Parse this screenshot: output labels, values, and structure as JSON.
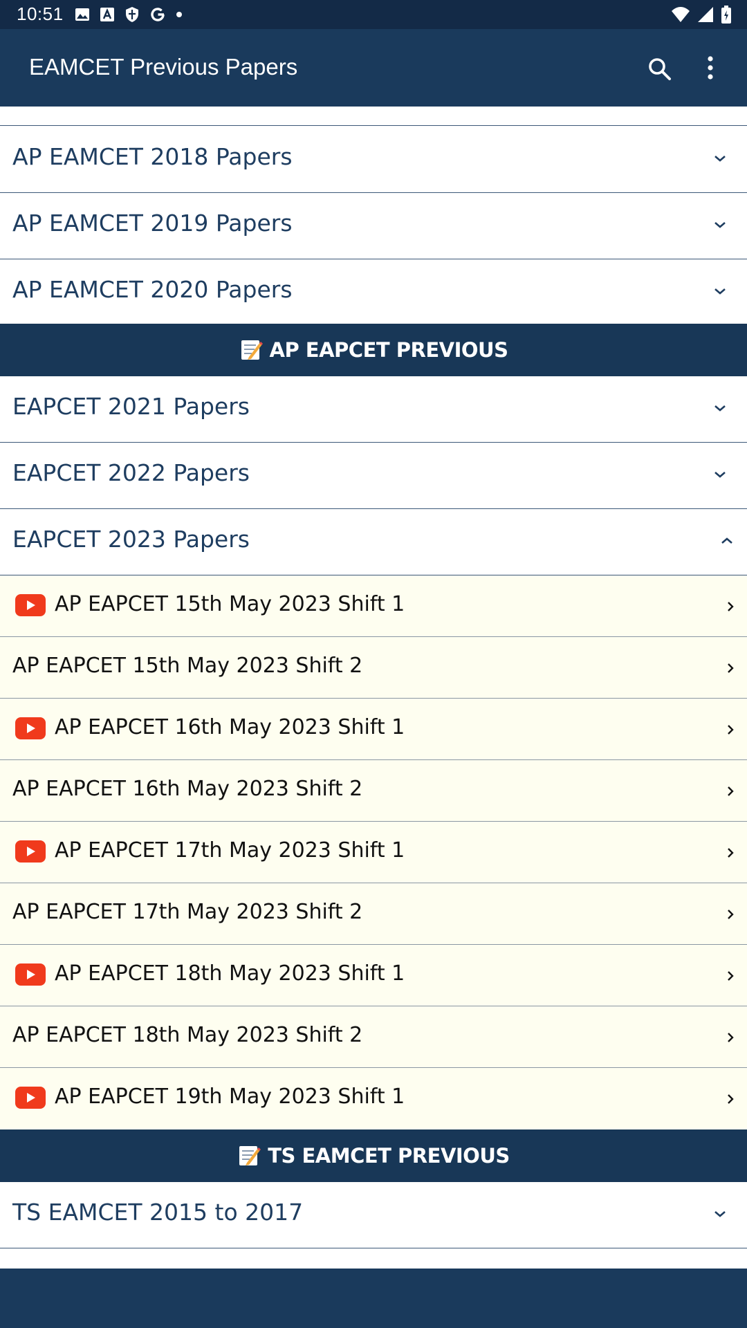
{
  "status_bar": {
    "time": "10:51",
    "left_icons": [
      "image-icon",
      "font-a-icon",
      "shield-icon",
      "google-g-icon",
      "dot-icon"
    ],
    "right_icons": [
      "wifi-icon",
      "signal-icon",
      "battery-icon"
    ]
  },
  "app_bar": {
    "title": "EAMCET Previous Papers",
    "actions": [
      "search-icon",
      "more-vert-icon"
    ]
  },
  "ap_eamcet_items": [
    {
      "label": "AP EAMCET 2018 Papers",
      "state": "collapsed"
    },
    {
      "label": "AP EAMCET 2019 Papers",
      "state": "collapsed"
    },
    {
      "label": "AP EAMCET 2020 Papers",
      "state": "collapsed"
    }
  ],
  "section_ap_eapcet": {
    "icon": "memo-emoji-icon",
    "title": "AP EAPCET PREVIOUS"
  },
  "eapcet_items": [
    {
      "label": "EAPCET 2021 Papers",
      "state": "collapsed"
    },
    {
      "label": "EAPCET 2022 Papers",
      "state": "collapsed"
    },
    {
      "label": "EAPCET 2023 Papers",
      "state": "expanded"
    }
  ],
  "papers_2023": [
    {
      "label": "AP EAPCET 15th May 2023 Shift 1",
      "video": true
    },
    {
      "label": "AP EAPCET 15th May 2023 Shift 2",
      "video": false
    },
    {
      "label": "AP EAPCET 16th May 2023 Shift 1",
      "video": true
    },
    {
      "label": "AP EAPCET 16th May 2023 Shift 2",
      "video": false
    },
    {
      "label": "AP EAPCET 17th May 2023 Shift 1",
      "video": true
    },
    {
      "label": "AP EAPCET 17th May 2023 Shift 2",
      "video": false
    },
    {
      "label": "AP EAPCET 18th May 2023 Shift 1",
      "video": true
    },
    {
      "label": "AP EAPCET 18th May 2023 Shift 2",
      "video": false
    },
    {
      "label": "AP EAPCET 19th May 2023 Shift 1",
      "video": true
    }
  ],
  "section_ts_eamcet": {
    "icon": "memo-emoji-icon",
    "title": "TS EAMCET PREVIOUS"
  },
  "ts_items": [
    {
      "label": "TS EAMCET 2015 to 2017",
      "state": "collapsed"
    }
  ],
  "colors": {
    "app_bar": "#1a3a5c",
    "section_header": "#183757",
    "accordion_text": "#1e3d60",
    "paper_row_bg": "#fefef0",
    "youtube_red": "#f03a1c"
  }
}
